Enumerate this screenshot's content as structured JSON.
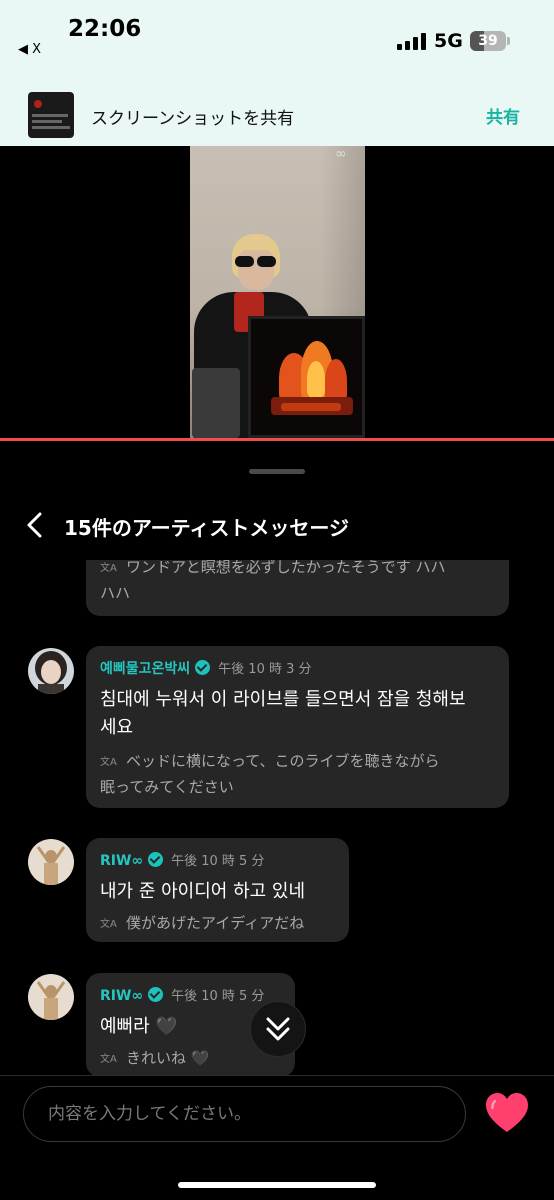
{
  "status_bar": {
    "time": "22:06",
    "back_app": "◀ X",
    "network": "5G",
    "battery": "39",
    "battery_level": 0.39
  },
  "share_banner": {
    "title": "スクリーンショットを共有",
    "action": "共有"
  },
  "video": {
    "progress": 1.0
  },
  "panel": {
    "title": "15件のアーティストメッセージ"
  },
  "messages": [
    {
      "translation_lines": [
        "ワンドアと瞑想を必ずしたかったそうです ハハ",
        "ハハ"
      ]
    },
    {
      "user": "예삐물고온박씨",
      "time": "午後 10 時 3 分",
      "text_lines": [
        "침대에 누워서 이 라이브를 들으면서 잠을 청해보",
        "세요"
      ],
      "translation_lines": [
        "ベッドに横になって、このライブを聴きながら",
        "眠ってみてください"
      ]
    },
    {
      "user": "RIW∞",
      "time": "午後 10 時 5 分",
      "text_lines": [
        "내가 준 아이디어 하고 있네"
      ],
      "translation_lines": [
        "僕があげたアイディアだね"
      ]
    },
    {
      "user": "RIW∞",
      "time": "午後 10 時 5 分",
      "text_lines": [
        "예뻐라 🖤"
      ],
      "translation_lines": [
        "きれいね 🖤"
      ]
    }
  ],
  "input": {
    "placeholder": "内容を入力してください。"
  },
  "icons": {
    "back": "chevron-left-icon",
    "verified": "verified-check-icon",
    "translate": "translate-icon",
    "scroll": "double-chevron-down-icon",
    "like": "heart-icon"
  },
  "colors": {
    "accent": "#26c6c0",
    "heart": "#ff3f6e",
    "progress": "#f04e4a",
    "banner_bg": "#e9f7f5"
  }
}
